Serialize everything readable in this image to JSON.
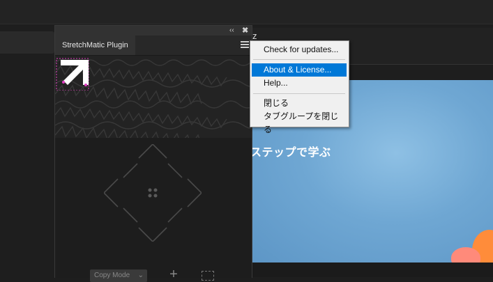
{
  "panel": {
    "tab_label": "StretchMatic Plugin",
    "collapse_glyph": "‹‹",
    "close_glyph": "✖",
    "mode_select": {
      "value": "Copy Mode",
      "options": [
        "Copy Mode"
      ]
    },
    "add_glyph": "+"
  },
  "host": {
    "tab_fragment": "z",
    "canvas_text": "ステップで学ぶ"
  },
  "context_menu": {
    "items": [
      {
        "label": "Check for updates..."
      },
      {
        "label": "About & License...",
        "highlighted": true
      },
      {
        "label": "Help..."
      },
      {
        "label": "閉じる"
      },
      {
        "label": "タブグループを閉じる"
      }
    ]
  },
  "colors": {
    "panel_bg": "#1d1d1d",
    "menu_highlight": "#0078d7",
    "logo_accent": "#e03cc0"
  },
  "icons": [
    "collapse-panel-icon",
    "close-panel-icon",
    "panel-menu-icon",
    "stretchmatic-logo",
    "arrow-up-icon",
    "arrow-down-icon",
    "arrow-left-icon",
    "arrow-right-icon",
    "center-dots-icon",
    "add-icon",
    "marquee-select-icon"
  ]
}
